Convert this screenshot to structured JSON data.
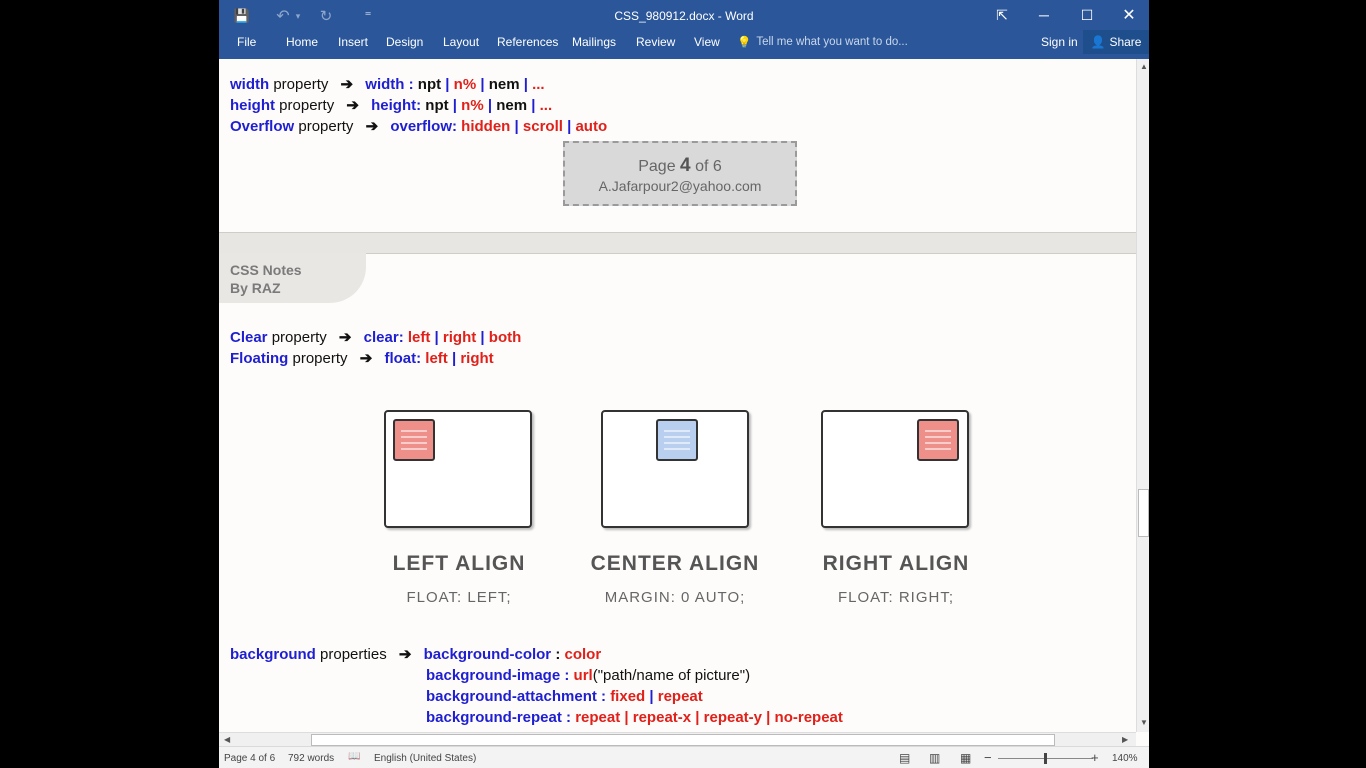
{
  "titlebar": {
    "title": "CSS_980912.docx - Word",
    "save_icon": "💾",
    "undo_icon": "↶",
    "undo_menu_icon": "▾",
    "redo_icon": "↻",
    "customize_icon": "⁼",
    "restore_ribbon_icon": "⇱",
    "minimize_icon": "─",
    "maximize_icon": "☐",
    "close_icon": "✕"
  },
  "ribbon": {
    "tabs": [
      "File",
      "Home",
      "Insert",
      "Design",
      "Layout",
      "References",
      "Mailings",
      "Review",
      "View"
    ],
    "tell_me": "Tell me what you want to do...",
    "tell_icon": "💡",
    "sign_in": "Sign in",
    "share": "Share",
    "share_icon": "👤"
  },
  "doc": {
    "lines_top": {
      "width_prop": "width",
      "width_word": "property",
      "width_sep": "width :",
      "height_prop": "height",
      "height_word": "property",
      "height_sep": "height:",
      "overflow_prop": "Overflow",
      "overflow_word": "property",
      "overflow_sep": "overflow:",
      "npt": "npt",
      "npct": "n%",
      "nem": "nem",
      "pipe": "|",
      "ellipsis": "...",
      "hidden": "hidden",
      "scroll": "scroll",
      "auto": "auto",
      "arrow": "➔"
    },
    "page_box": {
      "page_word": "Page",
      "page_num": "4",
      "of_text": "of 6",
      "email": "A.Jafarpour2@yahoo.com"
    },
    "header": {
      "title": "CSS Notes",
      "by": "By RAZ"
    },
    "clear_line": {
      "prop": "Clear",
      "word": "property",
      "sep": "clear:",
      "left": "left",
      "right": "right",
      "both": "both"
    },
    "float_line": {
      "prop": "Floating",
      "word": "property",
      "sep": "float:",
      "left": "left",
      "right": "right"
    },
    "figures": [
      {
        "title": "LEFT ALIGN",
        "sub": "FLOAT: LEFT;"
      },
      {
        "title": "CENTER ALIGN",
        "sub": "MARGIN: 0 AUTO;"
      },
      {
        "title": "RIGHT ALIGN",
        "sub": "FLOAT: RIGHT;"
      }
    ],
    "bg": {
      "prop": "background",
      "word": "properties",
      "color_key": "background-color",
      "color_sep": " : ",
      "color_val": "color",
      "image_key": "background-image :",
      "image_url": "url",
      "image_val": "(\"path/name of picture\")",
      "attach_key": "background-attachment :",
      "attach_fixed": "fixed",
      "attach_repeat": "repeat",
      "repeat_key": "background-repeat :",
      "repeat_vals": "repeat | repeat-x | repeat-y | no-repeat"
    }
  },
  "status": {
    "page": "Page 4 of 6",
    "words": "792 words",
    "proof_icon": "📖",
    "language": "English (United States)",
    "read_mode_icon": "▤",
    "print_layout_icon": "▥",
    "web_layout_icon": "▦",
    "zoom_out": "−",
    "zoom_in": "+",
    "zoom": "140%"
  },
  "colors": {
    "ribbon": "#2b579a",
    "keyword_blue": "#1f1fd1",
    "value_red": "#e0201a"
  }
}
